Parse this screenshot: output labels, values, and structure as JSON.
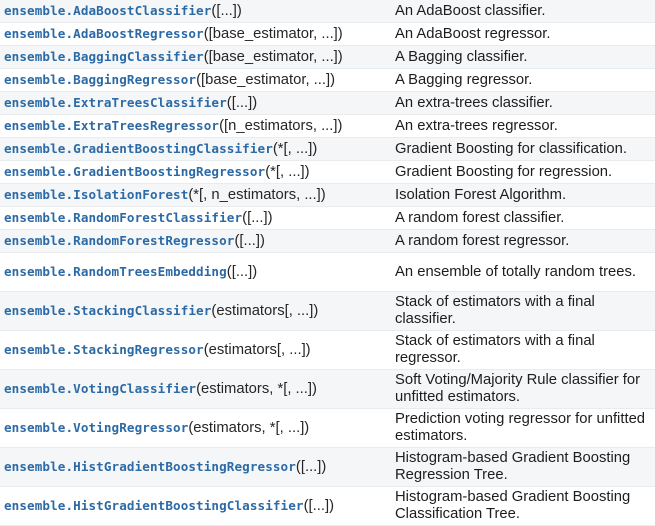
{
  "rows": [
    {
      "name": "ensemble.AdaBoostClassifier",
      "args": "([...])",
      "desc": "An AdaBoost classifier."
    },
    {
      "name": "ensemble.AdaBoostRegressor",
      "args": "([base_estimator, ...])",
      "desc": "An AdaBoost regressor."
    },
    {
      "name": "ensemble.BaggingClassifier",
      "args": "([base_estimator, ...])",
      "desc": "A Bagging classifier."
    },
    {
      "name": "ensemble.BaggingRegressor",
      "args": "([base_estimator, ...])",
      "desc": "A Bagging regressor."
    },
    {
      "name": "ensemble.ExtraTreesClassifier",
      "args": "([...])",
      "desc": "An extra-trees classifier."
    },
    {
      "name": "ensemble.ExtraTreesRegressor",
      "args": "([n_estimators, ...])",
      "desc": "An extra-trees regressor."
    },
    {
      "name": "ensemble.GradientBoostingClassifier",
      "args": "(*[, ...])",
      "desc": "Gradient Boosting for classification."
    },
    {
      "name": "ensemble.GradientBoostingRegressor",
      "args": "(*[, ...])",
      "desc": "Gradient Boosting for regression."
    },
    {
      "name": "ensemble.IsolationForest",
      "args": "(*[, n_estimators, ...])",
      "desc": "Isolation Forest Algorithm."
    },
    {
      "name": "ensemble.RandomForestClassifier",
      "args": "([...])",
      "desc": "A random forest classifier."
    },
    {
      "name": "ensemble.RandomForestRegressor",
      "args": "([...])",
      "desc": "A random forest regressor."
    },
    {
      "name": "ensemble.RandomTreesEmbedding",
      "args": "([...])",
      "desc": "An ensemble of totally random trees."
    },
    {
      "name": "ensemble.StackingClassifier",
      "args": "(estimators[, ...])",
      "desc": "Stack of estimators with a final classifier."
    },
    {
      "name": "ensemble.StackingRegressor",
      "args": "(estimators[, ...])",
      "desc": "Stack of estimators with a final regressor."
    },
    {
      "name": "ensemble.VotingClassifier",
      "args": "(estimators, *[, ...])",
      "desc": "Soft Voting/Majority Rule classifier for unfitted estimators."
    },
    {
      "name": "ensemble.VotingRegressor",
      "args": "(estimators, *[, ...])",
      "desc": "Prediction voting regressor for unfitted estimators."
    },
    {
      "name": "ensemble.HistGradientBoostingRegressor",
      "args": "([...])",
      "desc": "Histogram-based Gradient Boosting Regression Tree."
    },
    {
      "name": "ensemble.HistGradientBoostingClassifier",
      "args": "([...])",
      "desc": "Histogram-based Gradient Boosting Classification Tree."
    }
  ]
}
